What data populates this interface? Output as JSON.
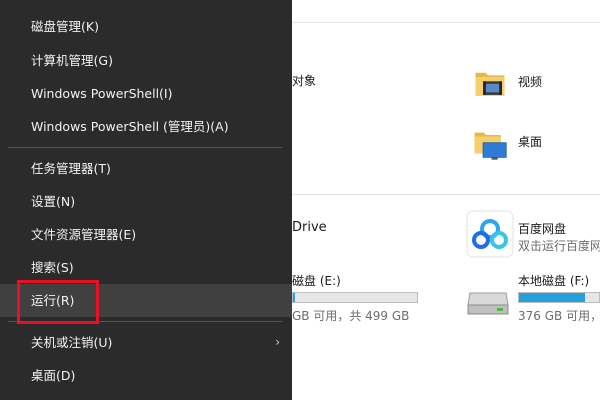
{
  "menu": {
    "items": [
      {
        "label": "磁盘管理(K)"
      },
      {
        "label": "计算机管理(G)"
      },
      {
        "label": "Windows PowerShell(I)"
      },
      {
        "label": "Windows PowerShell (管理员)(A)"
      },
      {
        "label": "任务管理器(T)"
      },
      {
        "label": "设置(N)"
      },
      {
        "label": "文件资源管理器(E)"
      },
      {
        "label": "搜索(S)"
      },
      {
        "label": "运行(R)"
      },
      {
        "label": "关机或注销(U)"
      },
      {
        "label": "桌面(D)"
      }
    ],
    "submenu_arrow": "›"
  },
  "explorer": {
    "folders": [
      {
        "partial_label": "对象"
      },
      {
        "label": "视频"
      },
      {
        "label": "桌面"
      }
    ],
    "onedrive_partial": "Drive",
    "baidu": {
      "label": "百度网盘",
      "sublabel": "双击运行百度网"
    },
    "drives": [
      {
        "label": "磁盘 (E:)",
        "sub": "GB 可用，共 499 GB",
        "used_fraction": 0.02
      },
      {
        "label": "本地磁盘 (F:)",
        "sub": "376 GB 可用，共",
        "used_fraction": 0.82
      }
    ]
  },
  "colors": {
    "menu_bg": "#2b2b2b",
    "menu_highlight": "#404040",
    "annotation_red": "#e81123",
    "drive_fill": "#26a0da"
  }
}
